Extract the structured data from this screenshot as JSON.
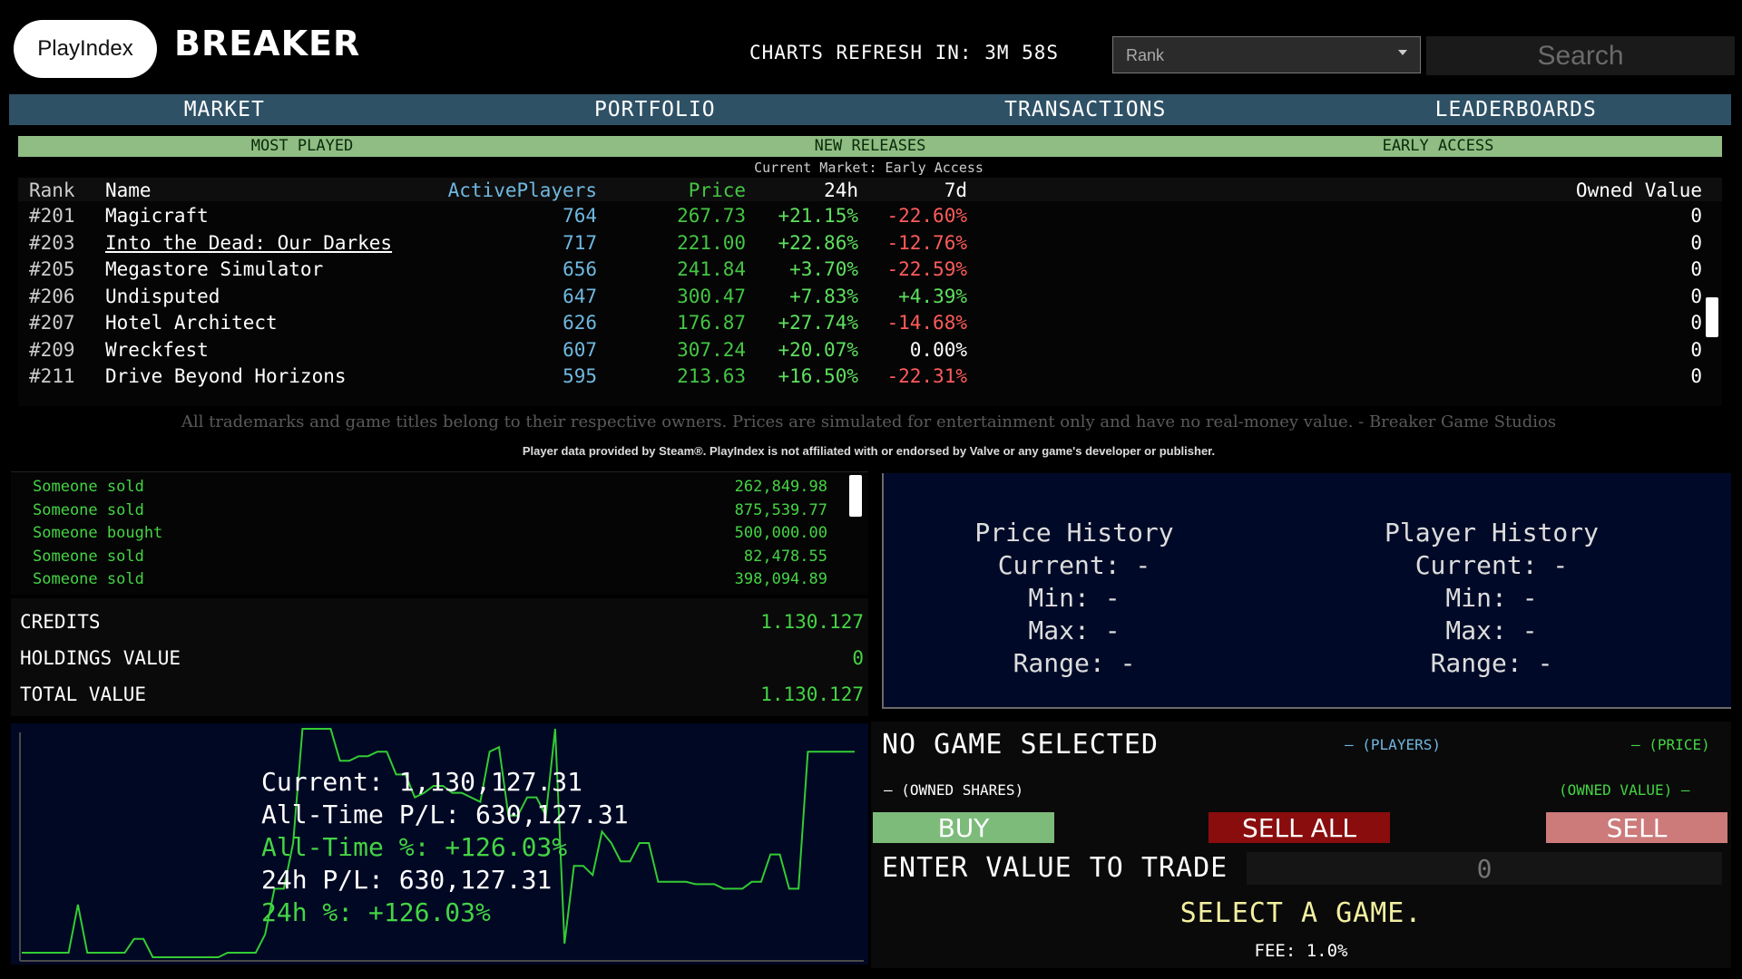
{
  "header": {
    "logo_text": "PlayIndex",
    "brand": "BREAKER",
    "refresh_text": "CHARTS REFRESH IN: 3M 58S",
    "sort_select": "Rank",
    "search_placeholder": "Search"
  },
  "nav": [
    "MARKET",
    "PORTFOLIO",
    "TRANSACTIONS",
    "LEADERBOARDS"
  ],
  "categories": [
    "MOST PLAYED",
    "NEW RELEASES",
    "EARLY ACCESS"
  ],
  "current_market": "Current Market: Early Access",
  "table": {
    "headers": {
      "rank": "Rank",
      "name": "Name",
      "players": "ActivePlayers",
      "price": "Price",
      "h24": "24h",
      "d7": "7d",
      "owned": "Owned Value"
    },
    "rows": [
      {
        "rank": "#201",
        "name": "Magicraft",
        "players": "764",
        "price": "267.73",
        "h24": "+21.15%",
        "d7": "-22.60%",
        "owned": "0"
      },
      {
        "rank": "#203",
        "name": "Into the Dead: Our Darkes",
        "players": "717",
        "price": "221.00",
        "h24": "+22.86%",
        "d7": "-12.76%",
        "owned": "0"
      },
      {
        "rank": "#205",
        "name": "Megastore Simulator",
        "players": "656",
        "price": "241.84",
        "h24": "+3.70%",
        "d7": "-22.59%",
        "owned": "0"
      },
      {
        "rank": "#206",
        "name": "Undisputed",
        "players": "647",
        "price": "300.47",
        "h24": "+7.83%",
        "d7": "+4.39%",
        "owned": "0"
      },
      {
        "rank": "#207",
        "name": "Hotel Architect",
        "players": "626",
        "price": "176.87",
        "h24": "+27.74%",
        "d7": "-14.68%",
        "owned": "0"
      },
      {
        "rank": "#209",
        "name": "Wreckfest",
        "players": "607",
        "price": "307.24",
        "h24": "+20.07%",
        "d7": "0.00%",
        "owned": "0"
      },
      {
        "rank": "#211",
        "name": "Drive Beyond Horizons",
        "players": "595",
        "price": "213.63",
        "h24": "+16.50%",
        "d7": "-22.31%",
        "owned": "0"
      }
    ]
  },
  "disclaimer": "All trademarks and game titles belong to their respective owners. Prices are simulated for entertainment only and have no real-money value. - Breaker Game Studios",
  "steam_note": "Player data provided by Steam®. PlayIndex is not affiliated with or endorsed by Valve or any game's developer or publisher.",
  "feed": [
    {
      "who": "Someone sold",
      "amount": "262,849.98"
    },
    {
      "who": "Someone sold",
      "amount": "875,539.77"
    },
    {
      "who": "Someone bought",
      "amount": "500,000.00"
    },
    {
      "who": "Someone sold",
      "amount": "82,478.55"
    },
    {
      "who": "Someone sold",
      "amount": "398,094.89"
    }
  ],
  "account": {
    "credits_label": "CREDITS",
    "credits": "1.130.127",
    "holdings_label": "HOLDINGS VALUE",
    "holdings": "0",
    "total_label": "TOTAL VALUE",
    "total": "1.130.127"
  },
  "portfolio_stats": {
    "current": "Current: 1,130,127.31",
    "pl": "All-Time P/L: 630,127.31",
    "pct": "All-Time %: +126.03%",
    "pl24": "24h P/L: 630,127.31",
    "pct24": "24h %: +126.03%"
  },
  "chart_data": {
    "type": "line",
    "series": [
      {
        "values": [
          0.02,
          0.02,
          0.02,
          0.02,
          0.02,
          0.02,
          0.23,
          0.02,
          0.02,
          0.02,
          0.02,
          0.02,
          0.08,
          0.08,
          0.0,
          0.0,
          0.0,
          0.0,
          0.0,
          0.0,
          0.0,
          0.0,
          0.02,
          0.02,
          0.02,
          0.02,
          0.1,
          0.3,
          0.3,
          0.5,
          1.0,
          1.0,
          1.0,
          1.0,
          0.86,
          0.86,
          0.88,
          0.88,
          0.9,
          0.9,
          0.8,
          0.8,
          0.7,
          0.72,
          0.75,
          0.75,
          0.72,
          0.72,
          0.7,
          0.68,
          0.9,
          0.92,
          0.62,
          0.62,
          0.7,
          0.7,
          0.62,
          1.0,
          0.06,
          0.4,
          0.4,
          0.36,
          0.55,
          0.5,
          0.42,
          0.42,
          0.5,
          0.5,
          0.33,
          0.33,
          0.33,
          0.33,
          0.32,
          0.32,
          0.32,
          0.3,
          0.3,
          0.3,
          0.33,
          0.33,
          0.45,
          0.45,
          0.3,
          0.3,
          0.9,
          0.9,
          0.9,
          0.9,
          0.9,
          0.9
        ]
      }
    ],
    "color": "#33cc33",
    "grid": false
  },
  "history": {
    "price": {
      "title": "Price History",
      "current": "Current: -",
      "min": "Min: -",
      "max": "Max: -",
      "range": "Range: -"
    },
    "player": {
      "title": "Player History",
      "current": "Current: -",
      "min": "Min: -",
      "max": "Max: -",
      "range": "Range: -"
    }
  },
  "trade": {
    "title": "NO GAME SELECTED",
    "legend_players": "(PLAYERS)",
    "legend_price": "(PRICE)",
    "legend_shares": "(OWNED SHARES)",
    "legend_owned": "(OWNED VALUE)",
    "buy": "BUY",
    "sell_all": "SELL ALL",
    "sell": "SELL",
    "enter_label": "ENTER VALUE TO TRADE",
    "input_placeholder": "0",
    "message": "SELECT A GAME.",
    "fee": "FEE: 1.0%"
  }
}
